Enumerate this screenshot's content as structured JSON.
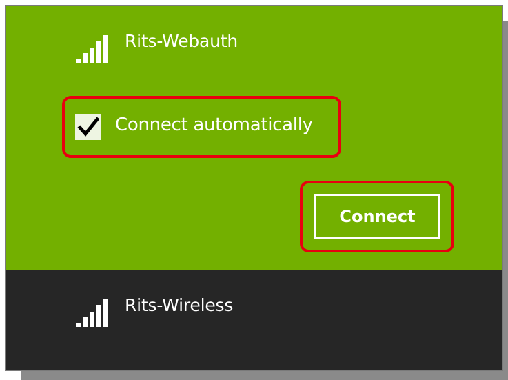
{
  "networks": [
    {
      "ssid": "Rits-Webauth",
      "icon": "wifi-signal-icon",
      "state": "selected",
      "connect_automatically": {
        "label": "Connect automatically",
        "checked": true
      },
      "connect_button_label": "Connect",
      "background_color": "#73b000"
    },
    {
      "ssid": "Rits-Wireless",
      "icon": "wifi-signal-icon",
      "state": "unselected",
      "background_color": "#262626"
    }
  ],
  "annotations": {
    "highlight_color": "#e8000f"
  }
}
